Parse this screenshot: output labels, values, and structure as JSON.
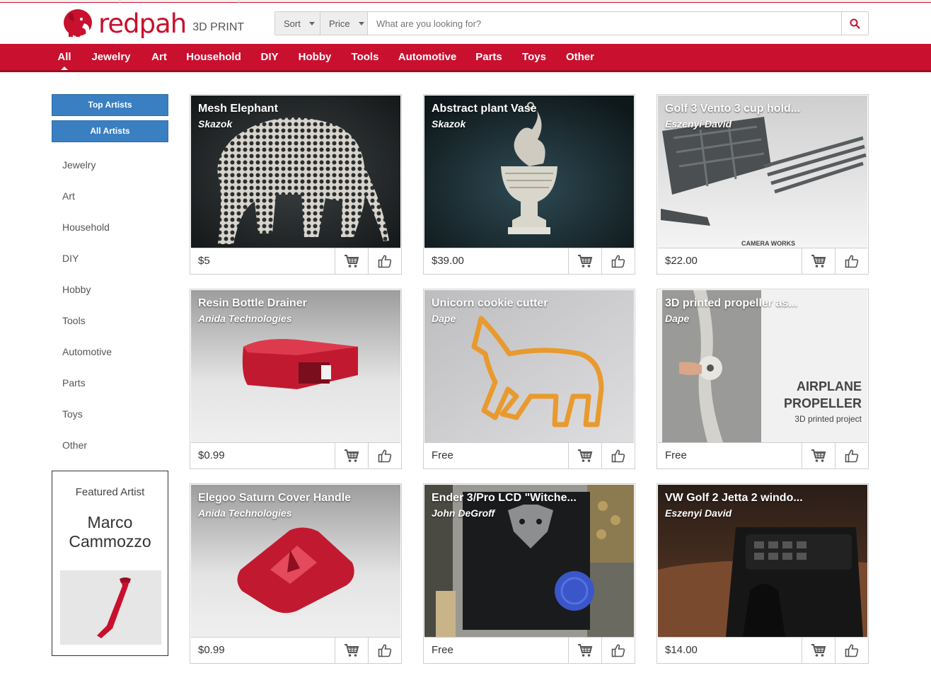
{
  "brand": {
    "name": "redpah",
    "tagline": "3D PRINT",
    "color": "#c9102e"
  },
  "search": {
    "sort_label": "Sort",
    "price_label": "Price",
    "placeholder": "What are you looking for?"
  },
  "nav": {
    "active": "All",
    "items": [
      "All",
      "Jewelry",
      "Art",
      "Household",
      "DIY",
      "Hobby",
      "Tools",
      "Automotive",
      "Parts",
      "Toys",
      "Other"
    ]
  },
  "sidebar": {
    "top_artists_label": "Top Artists",
    "all_artists_label": "All Artists",
    "categories": [
      "Jewelry",
      "Art",
      "Household",
      "DIY",
      "Hobby",
      "Tools",
      "Automotive",
      "Parts",
      "Toys",
      "Other"
    ],
    "featured": {
      "title": "Featured Artist",
      "name": "Marco Cammozzo"
    }
  },
  "products": [
    {
      "title": "Mesh Elephant",
      "artist": "Skazok",
      "price": "$5",
      "image": "mesh-elephant"
    },
    {
      "title": "Abstract plant Vase",
      "artist": "Skazok",
      "price": "$39.00",
      "image": "plant-vase"
    },
    {
      "title": "Golf 3 Vento 3 cup hold...",
      "artist": "Eszenyi David",
      "price": "$22.00",
      "image": "cup-holder",
      "image_caption": "CAMERA WORKS"
    },
    {
      "title": "Resin Bottle Drainer",
      "artist": "Anida Technologies",
      "price": "$0.99",
      "image": "bottle-drainer"
    },
    {
      "title": "Unicorn cookie cutter",
      "artist": "Dape",
      "price": "Free",
      "image": "cookie-cutter"
    },
    {
      "title": "3D printed propeller as...",
      "artist": "Dape",
      "price": "Free",
      "image": "propeller",
      "image_caption": "AIRPLANE PROPELLER",
      "image_subcaption": "3D printed project"
    },
    {
      "title": "Elegoo Saturn Cover Handle",
      "artist": "Anida Technologies",
      "price": "$0.99",
      "image": "cover-handle"
    },
    {
      "title": "Ender 3/Pro LCD \"Witche...",
      "artist": "John DeGroff",
      "price": "Free",
      "image": "lcd-case"
    },
    {
      "title": "VW Golf 2 Jetta 2 windo...",
      "artist": "Eszenyi David",
      "price": "$14.00",
      "image": "window-console"
    }
  ],
  "icons": {
    "cart": "cart-icon",
    "like": "thumbs-up-icon",
    "search": "search-icon"
  }
}
